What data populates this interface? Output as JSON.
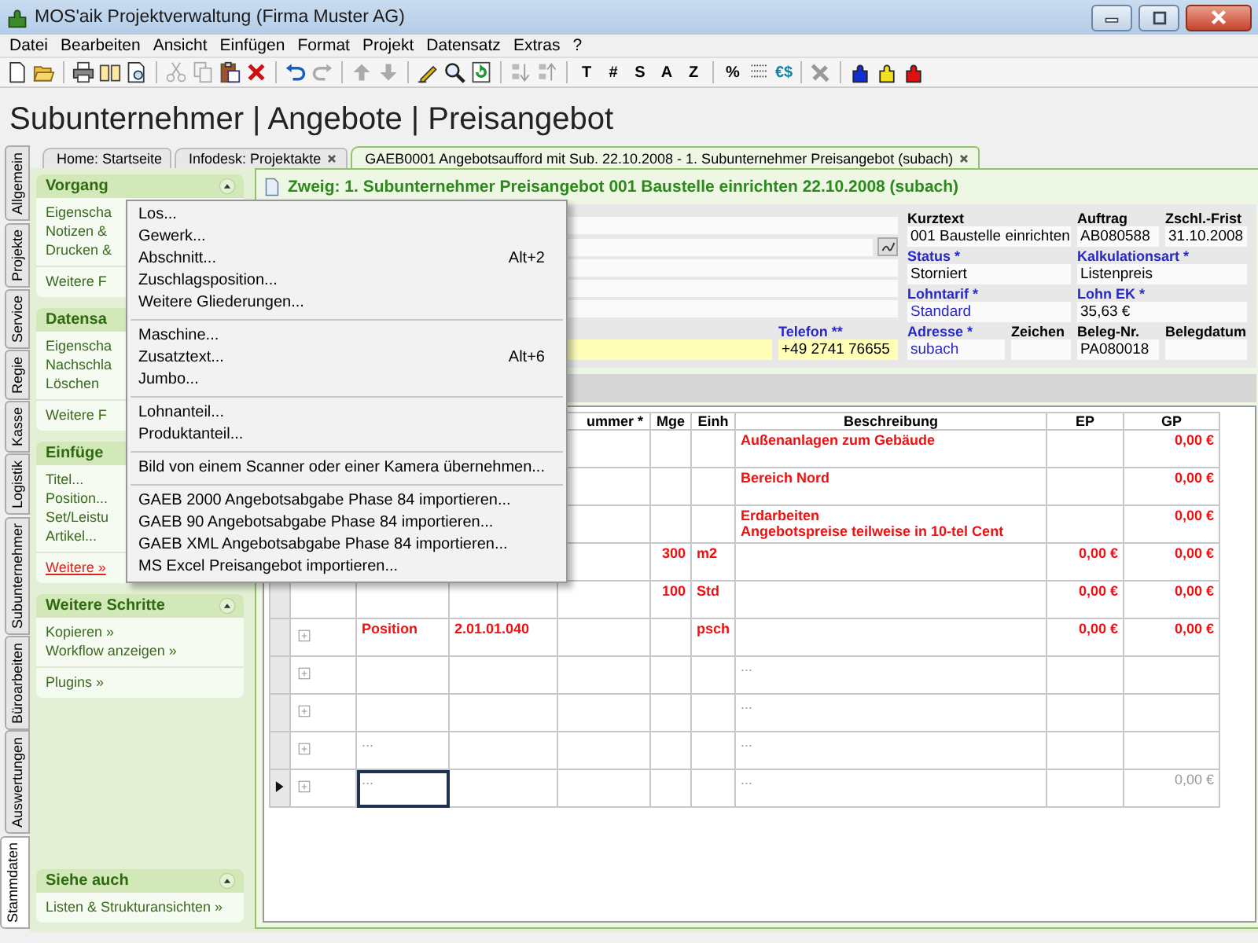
{
  "window": {
    "title": "MOS'aik Projektverwaltung (Firma Muster AG)"
  },
  "menu_bar": [
    "Datei",
    "Bearbeiten",
    "Ansicht",
    "Einfügen",
    "Format",
    "Projekt",
    "Datensatz",
    "Extras",
    "?"
  ],
  "toolbar": {
    "format_buttons": [
      "T",
      "#",
      "S",
      "A",
      "Z"
    ],
    "percent_button": "%",
    "currency_button": "€$"
  },
  "page_title": "Subunternehmer | Angebote | Preisangebot",
  "side_tabs": [
    {
      "label": "Allgemein",
      "selected": false
    },
    {
      "label": "Projekte",
      "selected": false
    },
    {
      "label": "Service",
      "selected": false
    },
    {
      "label": "Regie",
      "selected": false
    },
    {
      "label": "Kasse",
      "selected": false
    },
    {
      "label": "Logistik",
      "selected": false
    },
    {
      "label": "Subunternehmer",
      "selected": false
    },
    {
      "label": "Büroarbeiten",
      "selected": false
    },
    {
      "label": "Auswertungen",
      "selected": false
    },
    {
      "label": "Stammdaten",
      "selected": true
    }
  ],
  "doc_tabs": [
    {
      "label": "Home: Startseite",
      "closable": false,
      "selected": false
    },
    {
      "label": "Infodesk: Projektakte",
      "closable": true,
      "selected": false
    },
    {
      "label": "GAEB0001 Angebotsaufford mit Sub. 22.10.2008 - 1. Subunternehmer Preisangebot (subach)",
      "closable": true,
      "selected": true
    }
  ],
  "sidebar": {
    "sections": [
      {
        "title": "Vorgang",
        "collapse_button": true,
        "groups": [
          [
            {
              "label": "Eigenscha",
              "active": false
            },
            {
              "label": "Notizen &",
              "active": false
            },
            {
              "label": "Drucken &",
              "active": false
            }
          ],
          [
            {
              "label": "Weitere F",
              "active": false
            }
          ]
        ]
      },
      {
        "title": "Datensa",
        "groups": [
          [
            {
              "label": "Eigenscha",
              "active": false
            },
            {
              "label": "Nachschla",
              "active": false
            },
            {
              "label": "Löschen",
              "active": false
            }
          ],
          [
            {
              "label": "Weitere F",
              "active": false
            }
          ]
        ]
      },
      {
        "title": "Einfüge",
        "groups": [
          [
            {
              "label": "Titel...",
              "active": false
            },
            {
              "label": "Position...",
              "active": false
            },
            {
              "label": "Set/Leistu",
              "active": false
            },
            {
              "label": "Artikel...",
              "active": false
            }
          ],
          [
            {
              "label": "Weitere »",
              "active": true
            }
          ]
        ]
      },
      {
        "title": "Weitere Schritte",
        "collapse_button": true,
        "groups": [
          [
            {
              "label": "Kopieren »",
              "active": false
            },
            {
              "label": "Workflow anzeigen »",
              "active": false
            }
          ],
          [
            {
              "label": "Plugins »",
              "active": false
            }
          ]
        ]
      }
    ],
    "footer_section": {
      "title": "Siehe auch",
      "collapse_button": true,
      "groups": [
        [
          {
            "label": "Listen & Strukturansichten »",
            "active": false
          }
        ]
      ]
    }
  },
  "document": {
    "title": "Zweig: 1. Subunternehmer Preisangebot 001 Baustelle einrichten 22.10.2008 (subach)",
    "contact_fields": [
      {
        "highlighted": true
      },
      {
        "label": "Telefon **",
        "value": "+49 2741 76655",
        "required": true,
        "highlighted": true
      }
    ],
    "detail_rows": [
      [
        {
          "label": "Kurztext",
          "value": "001 Baustelle einrichten",
          "required": false
        },
        {
          "label": "Auftrag",
          "value": "AB080588",
          "required": false
        },
        {
          "label": "Zschl.-Frist",
          "value": "31.10.2008",
          "required": false
        }
      ],
      [
        {
          "label": "Status *",
          "value": "Storniert",
          "required": true
        },
        {
          "label": "Kalkulationsart *",
          "value": "Listenpreis",
          "required": true
        }
      ],
      [
        {
          "label": "Lohntarif *",
          "value": "Standard",
          "required": true,
          "link": true
        },
        {
          "label": "Lohn EK *",
          "value": "35,63 €",
          "required": true
        }
      ],
      [
        {
          "label": "Adresse *",
          "value": "subach",
          "required": true,
          "link": true
        },
        {
          "label": "Zeichen",
          "required": false
        },
        {
          "label": "Beleg-Nr.",
          "value": "PA080018",
          "required": false
        },
        {
          "label": "Belegdatum",
          "required": false
        }
      ]
    ]
  },
  "table": {
    "columns": [
      "ummer *",
      "Mge",
      "Einh",
      "Beschreibung",
      "EP",
      "GP"
    ],
    "rows": [
      {
        "kind": "entry",
        "beschreibung": "Außenanlagen zum Gebäude",
        "gp": "0,00 €"
      },
      {
        "kind": "entry",
        "beschreibung": "Bereich Nord",
        "gp": "0,00 €"
      },
      {
        "kind": "entry",
        "beschreibung": "Erdarbeiten\nAngebotspreise teilweise in 10-tel Cent",
        "gp": "0,00 €"
      },
      {
        "kind": "entry",
        "mge": "300",
        "einh": "m2",
        "ep": "0,00 €",
        "gp": "0,00 €"
      },
      {
        "kind": "entry",
        "mge": "100",
        "einh": "Std",
        "ep": "0,00 €",
        "gp": "0,00 €"
      },
      {
        "kind": "entry",
        "selected": false,
        "expander": true,
        "col_1": "Position",
        "col_2": "2.01.01.040",
        "einh": "psch",
        "ep": "0,00 €",
        "gp": "0,00 €"
      },
      {
        "kind": "new",
        "selected": false,
        "expander": true,
        "beschreibung": "..."
      },
      {
        "kind": "new",
        "selected": false,
        "expander": true,
        "beschreibung": "..."
      },
      {
        "kind": "new",
        "selected": false,
        "expander": true,
        "col_1": "...",
        "beschreibung": "..."
      },
      {
        "kind": "new",
        "selected": true,
        "expander": true,
        "col_1": "...",
        "beschreibung": "...",
        "gp": "0,00 €"
      }
    ]
  },
  "context_menu": {
    "groups": [
      [
        {
          "label": "Los..."
        },
        {
          "label": "Gewerk..."
        },
        {
          "label": "Abschnitt...",
          "shortcut": "Alt+2"
        },
        {
          "label": "Zuschlagsposition..."
        },
        {
          "label": "Weitere Gliederungen..."
        }
      ],
      [
        {
          "label": "Maschine..."
        },
        {
          "label": "Zusatztext...",
          "shortcut": "Alt+6"
        },
        {
          "label": "Jumbo..."
        }
      ],
      [
        {
          "label": "Lohnanteil..."
        },
        {
          "label": "Produktanteil..."
        }
      ],
      [
        {
          "label": "Bild von einem Scanner oder einer Kamera übernehmen..."
        }
      ],
      [
        {
          "label": "GAEB 2000 Angebotsabgabe Phase 84 importieren..."
        },
        {
          "label": "GAEB 90 Angebotsabgabe Phase 84 importieren..."
        },
        {
          "label": "GAEB XML Angebotsabgabe Phase 84 importieren..."
        },
        {
          "label": "MS Excel Preisangebot importieren..."
        }
      ]
    ]
  }
}
